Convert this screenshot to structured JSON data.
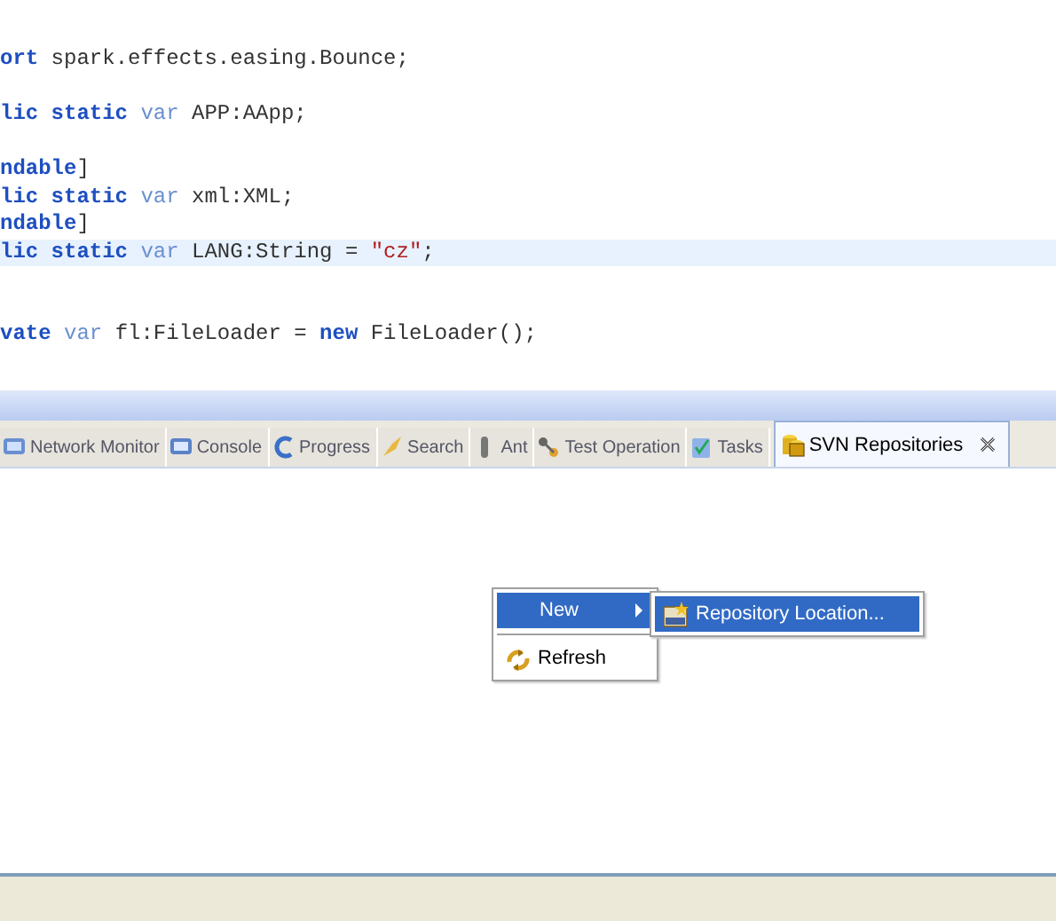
{
  "editor": {
    "lines": [
      {
        "current": false
      },
      {
        "current": false
      },
      {
        "current": false,
        "segments": [
          {
            "kind": "keyword",
            "text": "ort"
          },
          {
            "kind": "plain",
            "text": " spark.effects.easing.Bounce;"
          }
        ]
      },
      {
        "current": false
      },
      {
        "current": false,
        "segments": [
          {
            "kind": "keyword",
            "text": "lic static "
          },
          {
            "kind": "modifier",
            "text": "var"
          },
          {
            "kind": "plain",
            "text": " APP:AApp;"
          }
        ]
      },
      {
        "current": false
      },
      {
        "current": false,
        "segments": [
          {
            "kind": "keyword",
            "text": "ndable"
          },
          {
            "kind": "plain",
            "text": "]"
          }
        ]
      },
      {
        "current": false,
        "segments": [
          {
            "kind": "keyword",
            "text": "lic static "
          },
          {
            "kind": "modifier",
            "text": "var"
          },
          {
            "kind": "plain",
            "text": " xml:XML;"
          }
        ]
      },
      {
        "current": false,
        "segments": [
          {
            "kind": "keyword",
            "text": "ndable"
          },
          {
            "kind": "plain",
            "text": "]"
          }
        ]
      },
      {
        "current": true,
        "segments": [
          {
            "kind": "keyword",
            "text": "lic static "
          },
          {
            "kind": "modifier",
            "text": "var"
          },
          {
            "kind": "plain",
            "text": " LANG:String = "
          },
          {
            "kind": "string",
            "text": "\"cz\""
          },
          {
            "kind": "plain",
            "text": ";"
          }
        ]
      },
      {
        "current": false
      },
      {
        "current": false
      },
      {
        "current": false,
        "segments": [
          {
            "kind": "keyword",
            "text": "vate "
          },
          {
            "kind": "modifier",
            "text": "var"
          },
          {
            "kind": "plain",
            "text": " fl:FileLoader = "
          },
          {
            "kind": "keyword",
            "text": "new"
          },
          {
            "kind": "plain",
            "text": " FileLoader();"
          }
        ]
      }
    ]
  },
  "tabs": [
    {
      "label": "Network Monitor",
      "selected": false
    },
    {
      "label": "Console",
      "selected": false
    },
    {
      "label": "Progress",
      "selected": false
    },
    {
      "label": "Search",
      "selected": false
    },
    {
      "label": "Ant",
      "selected": false
    },
    {
      "label": "Test Operation",
      "selected": false
    },
    {
      "label": "Tasks",
      "selected": false
    },
    {
      "label": "SVN Repositories",
      "selected": true
    }
  ],
  "context_menu": {
    "items": [
      {
        "kind": "submenu",
        "label": "New",
        "selected": true,
        "submenu": {
          "items": [
            {
              "label": "Repository Location...",
              "selected": true
            }
          ]
        }
      },
      {
        "kind": "separator"
      },
      {
        "kind": "item",
        "label": "Refresh",
        "selected": false
      }
    ]
  }
}
